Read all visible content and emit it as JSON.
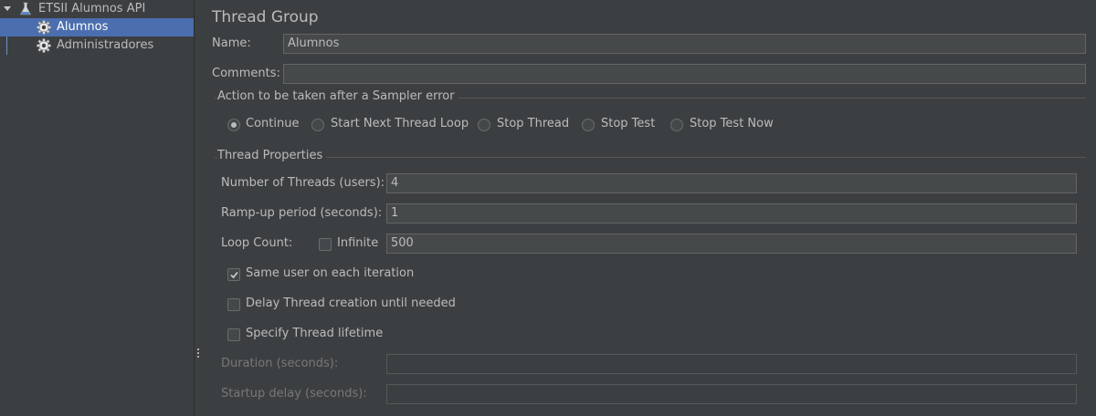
{
  "tree": {
    "root_label": "ETSII Alumnos API",
    "root_icon": "flask-icon",
    "items": [
      {
        "label": "Alumnos",
        "icon": "gear-icon",
        "selected": true
      },
      {
        "label": "Administradores",
        "icon": "gear-icon",
        "selected": false
      }
    ]
  },
  "panel": {
    "title": "Thread Group",
    "name_label": "Name:",
    "name_value": "Alumnos",
    "comments_label": "Comments:",
    "comments_value": "",
    "sampler_error": {
      "section_title": "Action to be taken after a Sampler error",
      "options": [
        "Continue",
        "Start Next Thread Loop",
        "Stop Thread",
        "Stop Test",
        "Stop Test Now"
      ],
      "selected": "Continue"
    },
    "thread_properties": {
      "section_title": "Thread Properties",
      "threads_label": "Number of Threads (users):",
      "threads_value": "4",
      "rampup_label": "Ramp-up period (seconds):",
      "rampup_value": "1",
      "loop_label": "Loop Count:",
      "infinite_label": "Infinite",
      "infinite_checked": false,
      "loop_value": "500",
      "same_user_label": "Same user on each iteration",
      "same_user_checked": true,
      "delay_label": "Delay Thread creation until needed",
      "delay_checked": false,
      "lifetime_label": "Specify Thread lifetime",
      "lifetime_checked": false,
      "duration_label": "Duration (seconds):",
      "duration_value": "",
      "startup_label": "Startup delay (seconds):",
      "startup_value": ""
    }
  }
}
